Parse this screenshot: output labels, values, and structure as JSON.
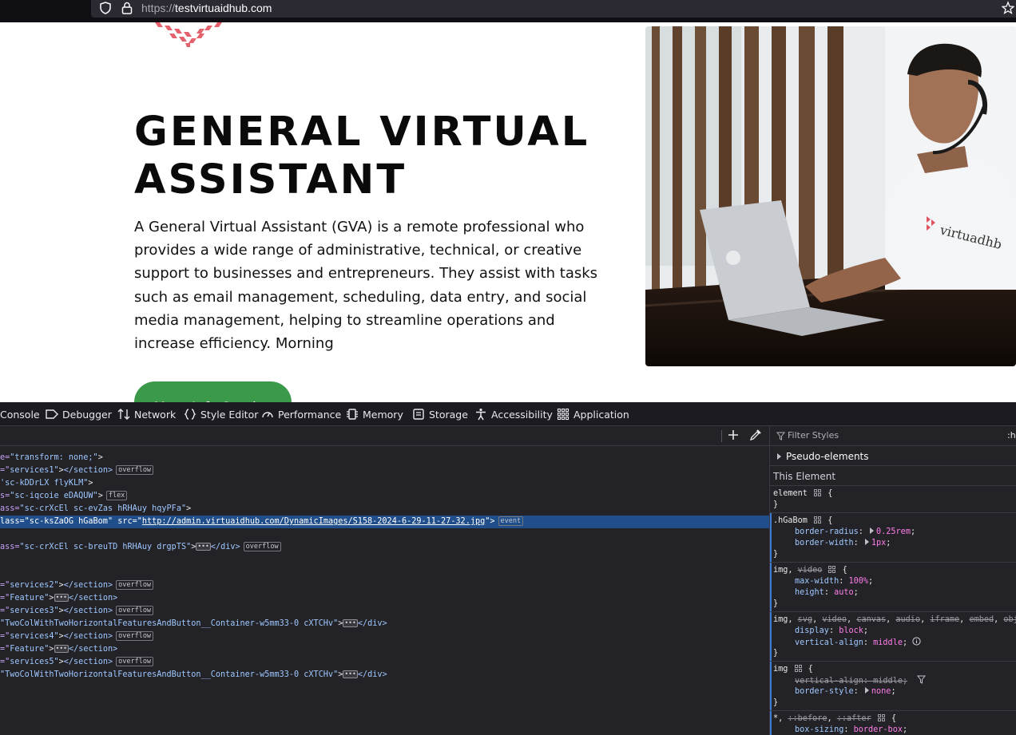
{
  "browser": {
    "url_protocol": "https://",
    "url_host": "testvirtuaidhub.com"
  },
  "hero": {
    "title_line1": "GENERAL VIRTUAL",
    "title_line2": "ASSISTANT",
    "description": "A General Virtual Assistant (GVA) is a remote professional who provides a wide range of administrative, technical, or creative support to businesses and entrepreneurs. They assist with tasks such as email management, scheduling, data entry, and social media management, helping to streamline operations and increase efficiency. Morning",
    "button_label": "More Info Service",
    "photo_shirt_text": "virtuadhb",
    "brand_color": "#e0525e",
    "button_color": "#3b9a4a"
  },
  "devtools": {
    "tabs": [
      "Console",
      "Debugger",
      "Network",
      "Style Editor",
      "Performance",
      "Memory",
      "Storage",
      "Accessibility",
      "Application"
    ],
    "markup_lines": [
      {
        "parts": [
          [
            "attr",
            "e="
          ],
          [
            "val",
            "\"transform: none;\""
          ],
          [
            "txt",
            ">"
          ]
        ]
      },
      {
        "parts": [
          [
            "attr",
            "=\""
          ],
          [
            "val",
            "services1\""
          ],
          [
            "txt",
            ">"
          ],
          [
            "tag",
            "</section>"
          ]
        ],
        "badge": "overflow"
      },
      {
        "parts": [
          [
            "val",
            "'sc-kDDrLX flyKLM\""
          ],
          [
            "txt",
            ">"
          ]
        ]
      },
      {
        "parts": [
          [
            "attr",
            "s="
          ],
          [
            "val",
            "\"sc-iqcoie eDAQUW\""
          ],
          [
            "txt",
            ">"
          ]
        ],
        "badge": "flex"
      },
      {
        "parts": [
          [
            "attr",
            "ass="
          ],
          [
            "val",
            "\"sc-crXcEl sc-evZas hRHAuy hqyPFa\""
          ],
          [
            "txt",
            ">"
          ]
        ]
      },
      {
        "parts": [
          [
            "attr",
            "lass="
          ],
          [
            "val",
            "\"sc-ksZaOG hGaBom\""
          ],
          [
            "attr",
            " src="
          ],
          [
            "val",
            "\""
          ],
          [
            "link",
            "http://admin.virtuaidhub.com/DynamicImages/S158-2024-6-29-11-27-32.jpg"
          ],
          [
            "val",
            "\""
          ],
          [
            "txt",
            ">"
          ]
        ],
        "badge": "event",
        "selected": true
      },
      {
        "parts": []
      },
      {
        "parts": [
          [
            "attr",
            "ass="
          ],
          [
            "val",
            "\"sc-crXcEl sc-breuTD hRHAuy drgpTS\""
          ],
          [
            "txt",
            ">"
          ]
        ],
        "ellipsis": true,
        "after": "</div>",
        "badge": "overflow"
      },
      {
        "parts": []
      },
      {
        "parts": []
      },
      {
        "parts": [
          [
            "attr",
            "=\""
          ],
          [
            "val",
            "services2\""
          ],
          [
            "txt",
            ">"
          ],
          [
            "tag",
            "</section>"
          ]
        ],
        "badge": "overflow"
      },
      {
        "parts": [
          [
            "attr",
            "=\""
          ],
          [
            "val",
            "Feature\""
          ],
          [
            "txt",
            ">"
          ]
        ],
        "ellipsis": true,
        "after": "</section>"
      },
      {
        "parts": [
          [
            "attr",
            "=\""
          ],
          [
            "val",
            "services3\""
          ],
          [
            "txt",
            ">"
          ],
          [
            "tag",
            "</section>"
          ]
        ],
        "badge": "overflow"
      },
      {
        "parts": [
          [
            "val",
            "\"TwoColWithTwoHorizontalFeaturesAndButton__Container-w5mm33-0 cXTCHv\""
          ],
          [
            "txt",
            ">"
          ]
        ],
        "ellipsis": true,
        "after": "</div>"
      },
      {
        "parts": [
          [
            "attr",
            "=\""
          ],
          [
            "val",
            "services4\""
          ],
          [
            "txt",
            ">"
          ],
          [
            "tag",
            "</section>"
          ]
        ],
        "badge": "overflow"
      },
      {
        "parts": [
          [
            "attr",
            "=\""
          ],
          [
            "val",
            "Feature\""
          ],
          [
            "txt",
            ">"
          ]
        ],
        "ellipsis": true,
        "after": "</section>"
      },
      {
        "parts": [
          [
            "attr",
            "=\""
          ],
          [
            "val",
            "services5\""
          ],
          [
            "txt",
            ">"
          ],
          [
            "tag",
            "</section>"
          ]
        ],
        "badge": "overflow"
      },
      {
        "parts": [
          [
            "val",
            "\"TwoColWithTwoHorizontalFeaturesAndButton__Container-w5mm33-0 cXTCHv\""
          ],
          [
            "txt",
            ">"
          ]
        ],
        "ellipsis": true,
        "after": "</div>"
      }
    ],
    "styles": {
      "filter_placeholder": "Filter Styles",
      "hov_label": ":h",
      "pseudo_elements": "Pseudo-elements",
      "this_element": "This Element",
      "rules": [
        {
          "selector": "element",
          "grid": true,
          "decls": []
        },
        {
          "selector": ".hGaBom",
          "grid": true,
          "decls": [
            {
              "name": "border-radius",
              "value": "0.25rem",
              "expander": true
            },
            {
              "name": "border-width",
              "value": "1px",
              "expander": true
            }
          ]
        },
        {
          "selector": "img, <s>video</s>",
          "grid": true,
          "decls": [
            {
              "name": "max-width",
              "value": "100%"
            },
            {
              "name": "height",
              "value": "auto"
            }
          ]
        },
        {
          "selector": "img, <s>svg</s>, <s>video</s>, <s>canvas</s>, <s>audio</s>, <s>iframe</s>, <s>embed</s>, <s>obje</s>",
          "grid": false,
          "decls": [
            {
              "name": "display",
              "value": "block"
            },
            {
              "name": "vertical-align",
              "value": "middle",
              "info": true
            }
          ]
        },
        {
          "selector": "img",
          "grid": true,
          "decls": [
            {
              "name": "vertical-align",
              "value": "middle",
              "struck": true,
              "filter": true
            },
            {
              "name": "border-style",
              "value": "none",
              "expander": true
            }
          ]
        },
        {
          "selector": "*, <s>::before</s>, <s>::after</s>",
          "grid": true,
          "decls": [
            {
              "name": "box-sizing",
              "value": "border-box"
            }
          ],
          "noclose": true
        }
      ]
    }
  }
}
